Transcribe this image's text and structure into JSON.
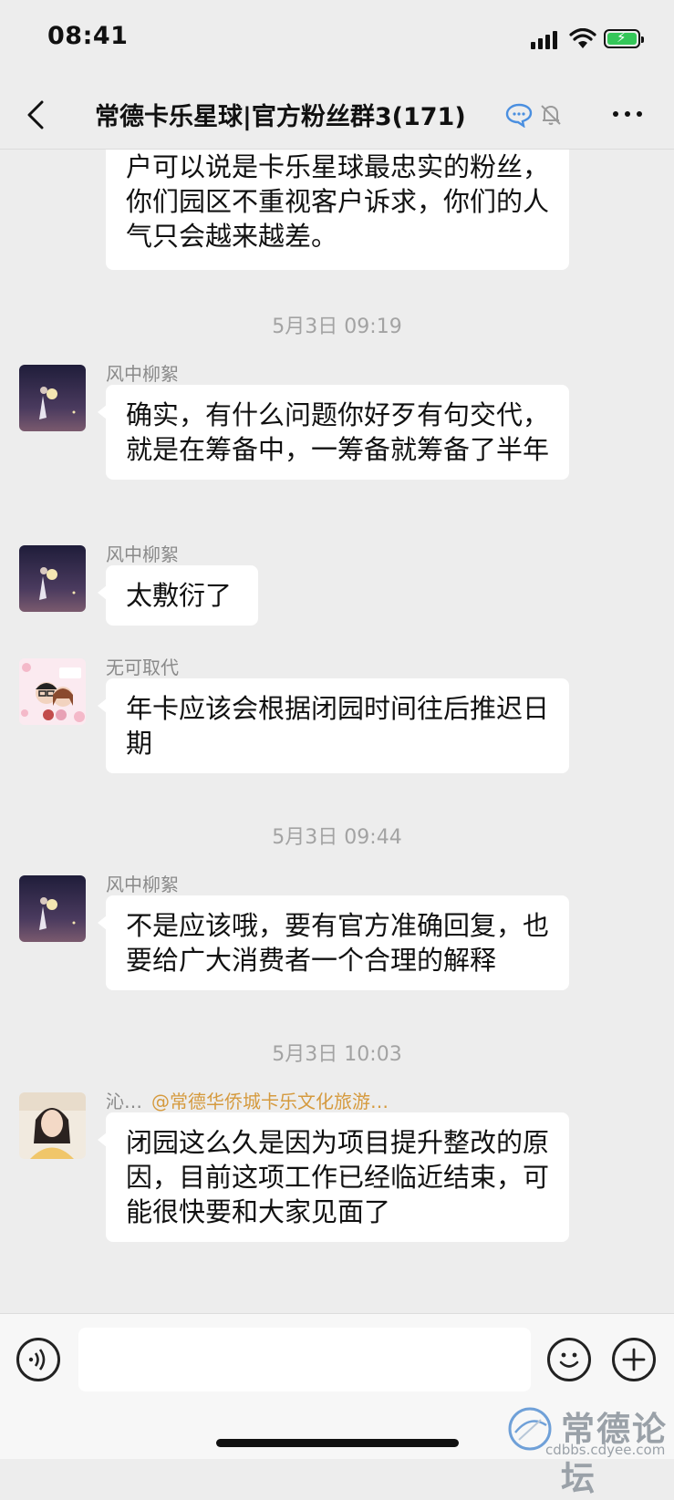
{
  "status_bar": {
    "time": "08:41"
  },
  "header": {
    "title": "常德卡乐星球|官方粉丝群3(171)"
  },
  "messages": [
    {
      "type": "text",
      "text": "户可以说是卡乐星球最忠实的粉丝，你们园区不重视客户诉求，你们的人气只会越来越差。"
    },
    {
      "type": "timestamp",
      "text": "5月3日 09:19"
    },
    {
      "type": "text",
      "sender": "风中柳絮",
      "text": "确实，有什么问题你好歹有句交代，就是在筹备中，一筹备就筹备了半年"
    },
    {
      "type": "text",
      "sender": "风中柳絮",
      "text": "太敷衍了"
    },
    {
      "type": "text",
      "sender": "无可取代",
      "text": "年卡应该会根据闭园时间往后推迟日期"
    },
    {
      "type": "timestamp",
      "text": "5月3日 09:44"
    },
    {
      "type": "text",
      "sender": "风中柳絮",
      "text": "不是应该哦，要有官方准确回复，也要给广大消费者一个合理的解释"
    },
    {
      "type": "timestamp",
      "text": "5月3日 10:03"
    },
    {
      "type": "text",
      "sender": "沁…",
      "mention": "@常德华侨城卡乐文化旅游…",
      "text": "闭园这么久是因为项目提升整改的原因，目前这项工作已经临近结束，可能很快要和大家见面了"
    }
  ],
  "watermark": {
    "name": "常德论坛",
    "url": "cdbbs.cdyee.com"
  }
}
